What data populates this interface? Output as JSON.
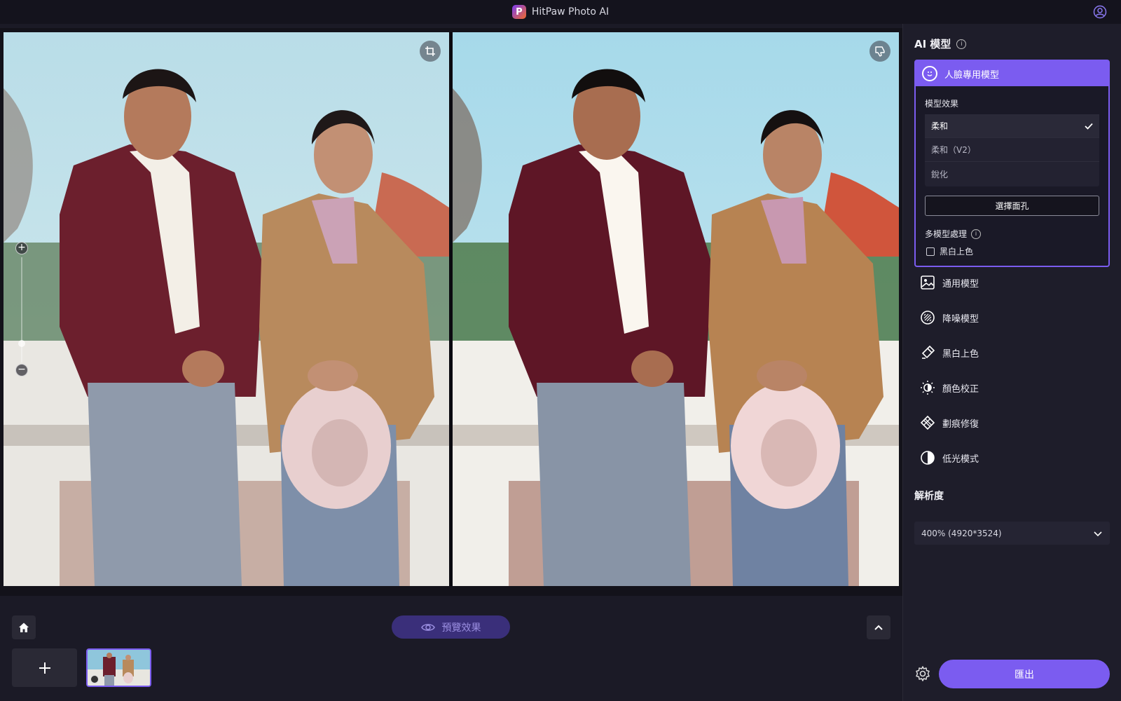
{
  "app": {
    "title": "HitPaw Photo AI",
    "logo_letter": "P"
  },
  "canvas": {
    "left_overlay_icon": "crop-icon",
    "right_overlay_icon": "thumbs-down-icon",
    "zoom_in_label": "+",
    "zoom_out_label": "−"
  },
  "bottom": {
    "preview_label": "預覽效果",
    "add_label": "+"
  },
  "sidebar": {
    "ai_model_heading": "AI 模型",
    "face_model": {
      "title": "人臉專用模型",
      "effect_label": "模型效果",
      "effects": [
        {
          "label": "柔和",
          "selected": true
        },
        {
          "label": "柔和（V2）",
          "selected": false
        },
        {
          "label": "銳化",
          "selected": false
        }
      ],
      "select_face_button": "選擇面孔",
      "multi_model_label": "多模型處理",
      "bw_colorize_checkbox": "黑白上色"
    },
    "models": [
      {
        "label": "通用模型",
        "icon": "image-icon"
      },
      {
        "label": "降噪模型",
        "icon": "denoise-icon"
      },
      {
        "label": "黑白上色",
        "icon": "colorize-icon"
      },
      {
        "label": "顏色校正",
        "icon": "brightness-icon"
      },
      {
        "label": "劃痕修復",
        "icon": "scratch-repair-icon"
      },
      {
        "label": "低光模式",
        "icon": "low-light-icon"
      }
    ],
    "resolution_heading": "解析度",
    "resolution_value": "400% (4920*3524)",
    "export_label": "匯出"
  },
  "colors": {
    "accent": "#7b5cf0",
    "background": "#1b1a26",
    "panel": "#1e1d2a"
  }
}
